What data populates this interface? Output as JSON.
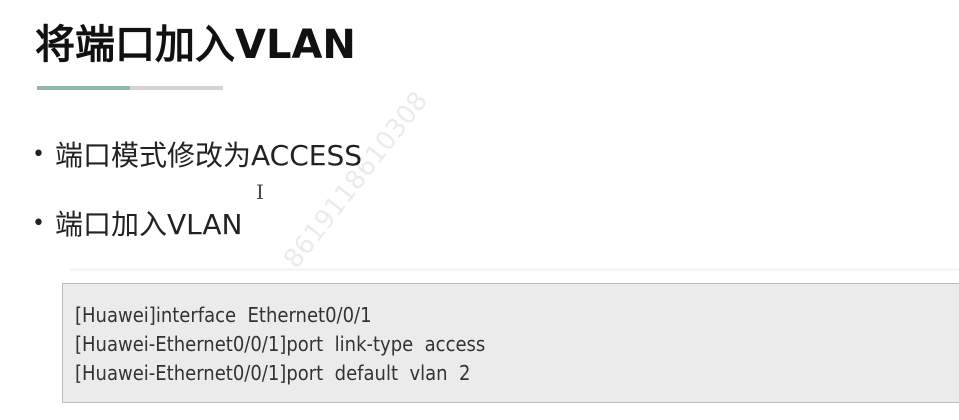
{
  "slide": {
    "title": "将端口加入VLAN",
    "progress_percent": 50,
    "accent_color": "#8fb7ad",
    "bullets": [
      {
        "text": "端口模式修改为ACCESS"
      },
      {
        "text": "端口加入VLAN"
      }
    ],
    "code_lines": [
      "[Huawei]interface  Ethernet0/0/1",
      "[Huawei-Ethernet0/0/1]port  link-type  access",
      "[Huawei-Ethernet0/0/1]port  default  vlan  2"
    ],
    "cursor_glyph": "I",
    "watermark": "8619118610308"
  }
}
